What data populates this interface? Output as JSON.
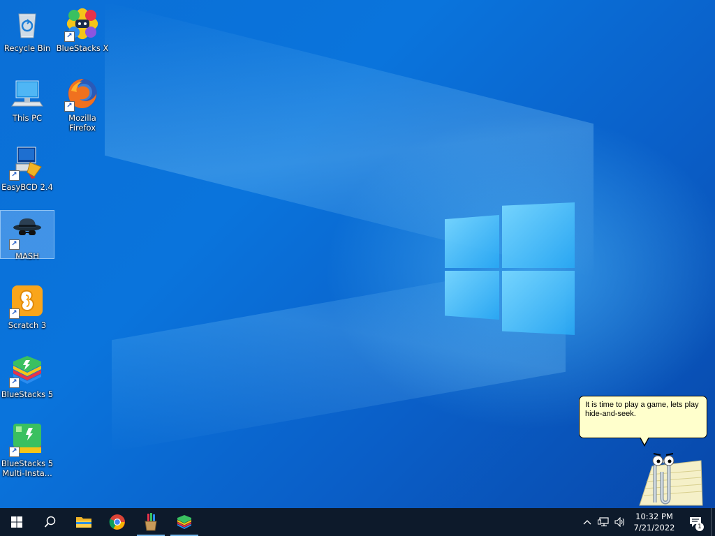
{
  "desktop": {
    "icons": [
      {
        "label": "Recycle Bin",
        "icon": "recycle-bin-icon"
      },
      {
        "label": "BlueStacks X",
        "icon": "bluestacks-x-icon"
      },
      {
        "label": "This PC",
        "icon": "computer-icon"
      },
      {
        "label": "Mozilla Firefox",
        "icon": "firefox-icon"
      },
      {
        "label": "EasyBCD 2.4",
        "icon": "easybcd-icon"
      },
      {
        "label": "MASH",
        "icon": "spy-hat-icon"
      },
      {
        "label": "Scratch 3",
        "icon": "scratch-icon"
      },
      {
        "label": "BlueStacks 5",
        "icon": "bluestacks-icon"
      },
      {
        "label": "BlueStacks 5 Multi-Insta...",
        "icon": "bluestacks-multi-icon"
      }
    ]
  },
  "assistant": {
    "message": "It is time to play a game, lets play hide-and-seek."
  },
  "taskbar": {
    "pinned": [
      "start-icon",
      "search-icon",
      "file-explorer-icon",
      "chrome-icon",
      "pencil-cup-icon",
      "bluestacks-icon"
    ],
    "clock": {
      "time": "10:32 PM",
      "date": "7/21/2022"
    },
    "notifications_count": "1"
  },
  "colors": {
    "taskbar": "#0d1a2b",
    "desktop": "#0a6fd8",
    "balloon": "#ffffcc"
  }
}
